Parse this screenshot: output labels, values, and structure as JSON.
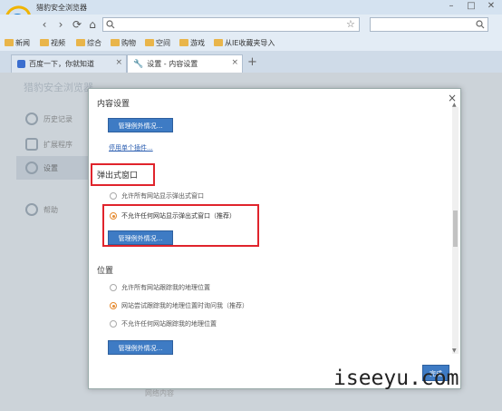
{
  "window": {
    "title": "猎豹安全浏览器",
    "min": "–",
    "max": "□",
    "close": "✕"
  },
  "nav": {
    "back": "‹",
    "forward": "›",
    "refresh": "⟳",
    "home": "⌂",
    "search_icon": "search-icon",
    "star": "☆"
  },
  "bookmarks": [
    "新闻",
    "视频",
    "综合",
    "购物",
    "空间",
    "游戏",
    "从IE收藏夹导入"
  ],
  "tabs": [
    {
      "label": "百度一下，你就知道",
      "close": "×"
    },
    {
      "label": "设置 - 内容设置",
      "close": "×"
    }
  ],
  "new_tab": "+",
  "sidebar": {
    "brand": "猎豹安全浏览器",
    "items": [
      {
        "label": "历史记录",
        "icon": "clock-icon"
      },
      {
        "label": "扩展程序",
        "icon": "puzzle-icon"
      },
      {
        "label": "设置",
        "icon": "gear-icon"
      },
      {
        "label": "帮助",
        "icon": "info-icon"
      }
    ]
  },
  "dialog": {
    "title": "内容设置",
    "close": "×",
    "manage_label": "管理例外情况...",
    "plugins_link": "停用单个插件...",
    "popups": {
      "heading": "弹出式窗口",
      "options": [
        "允许所有网站显示弹出式窗口",
        "不允许任何网站显示弹出式窗口（推荐）"
      ],
      "selected": 1,
      "manage_label": "管理例外情况..."
    },
    "location": {
      "heading": "位置",
      "options": [
        "允许所有网站跟踪我的地理位置",
        "网站尝试跟踪我的地理位置时询问我（推荐）",
        "不允许任何网站跟踪我的地理位置"
      ],
      "selected": 1,
      "manage_label": "管理例外情况..."
    },
    "done": "完成",
    "bg_text": "网络内容"
  },
  "watermark": "iseeyu.com",
  "colors": {
    "accent": "#3e7bc4",
    "highlight": "#e0242c",
    "radio_on": "#e58a2f"
  }
}
